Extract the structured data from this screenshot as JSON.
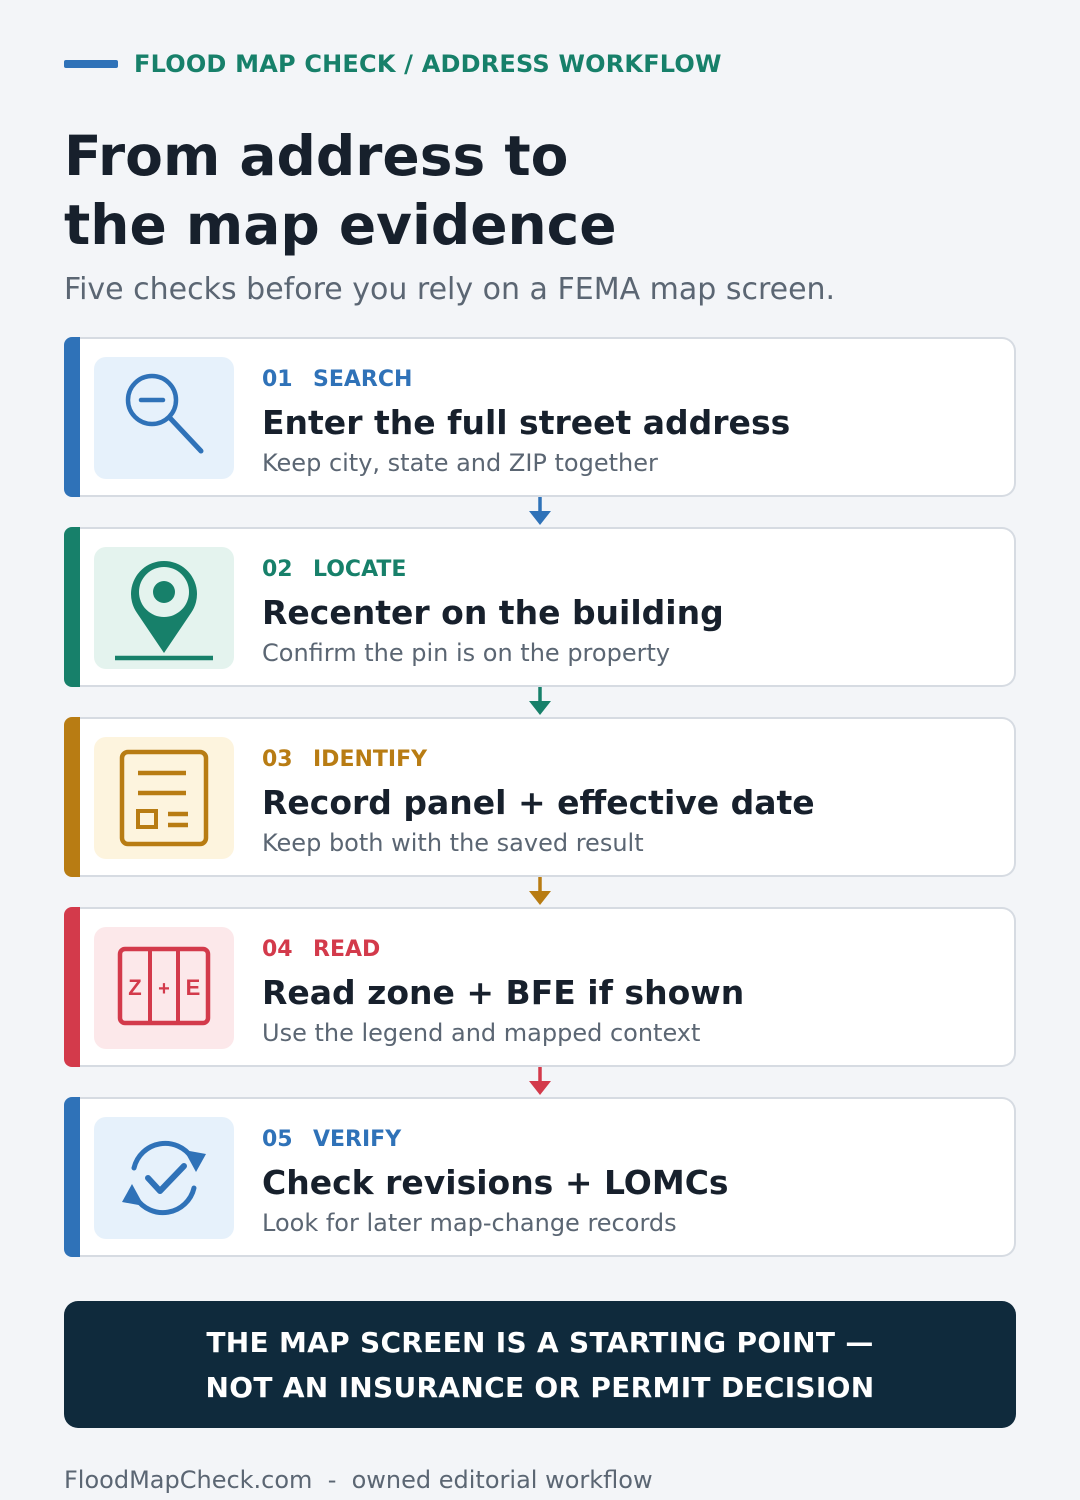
{
  "header": {
    "kicker": "FLOOD MAP CHECK / ADDRESS WORKFLOW",
    "title_line1": "From address to",
    "title_line2": "the map evidence",
    "subtitle": "Five checks before you rely on a FEMA map screen."
  },
  "steps": [
    {
      "num": "01",
      "tag": "SEARCH",
      "title": "Enter the full street address",
      "desc": "Keep city, state and ZIP together",
      "color": "#2f72b8",
      "tint": "#e6f1fb",
      "icon": "search-icon"
    },
    {
      "num": "02",
      "tag": "LOCATE",
      "title": "Recenter on the building",
      "desc": "Confirm the pin is on the property",
      "color": "#17806a",
      "tint": "#e4f3ee",
      "icon": "map-pin-icon"
    },
    {
      "num": "03",
      "tag": "IDENTIFY",
      "title": "Record panel + effective date",
      "desc": "Keep both with the saved result",
      "color": "#b87c13",
      "tint": "#fdf4de",
      "icon": "document-panel-icon"
    },
    {
      "num": "04",
      "tag": "READ",
      "title": "Read zone + BFE if shown",
      "desc": "Use the legend and mapped context",
      "color": "#d33a4b",
      "tint": "#fce8ea",
      "icon": "zone-legend-icon"
    },
    {
      "num": "05",
      "tag": "VERIFY",
      "title": "Check revisions + LOMCs",
      "desc": "Look for later map-change records",
      "color": "#2f72b8",
      "tint": "#e6f1fb",
      "icon": "refresh-check-icon"
    }
  ],
  "zone_icon": {
    "left": "Z",
    "mid": "+",
    "right": "E"
  },
  "banner": {
    "line1": "THE MAP SCREEN IS A STARTING POINT —",
    "line2": "NOT AN INSURANCE OR PERMIT DECISION"
  },
  "footer": "FloodMapCheck.com  -  owned editorial workflow"
}
